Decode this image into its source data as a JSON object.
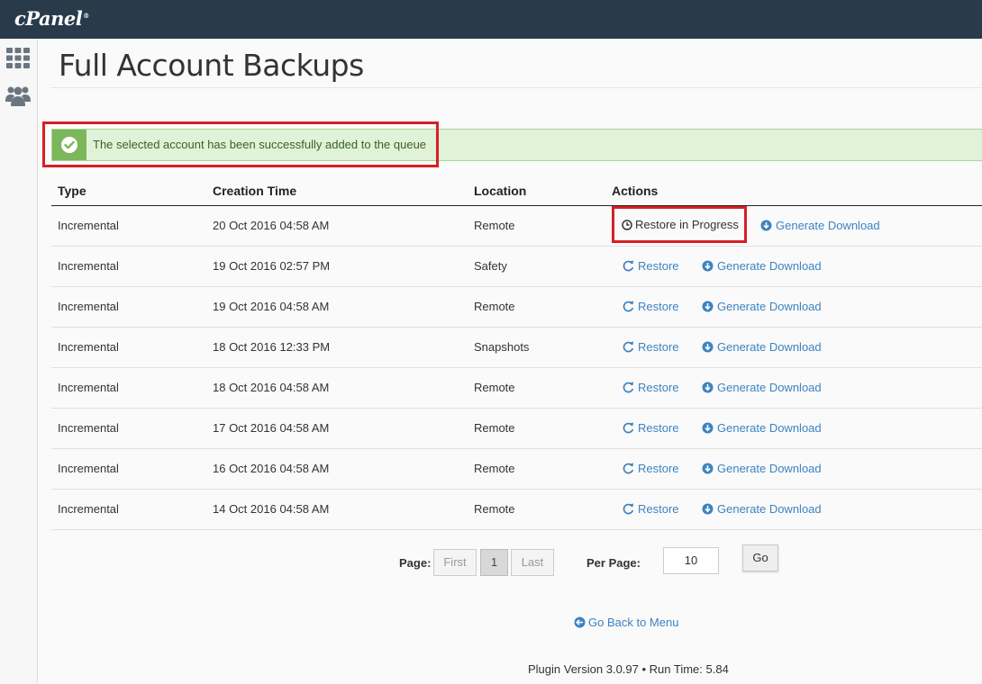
{
  "app": {
    "logo": "cPanel",
    "logo_mark": "®"
  },
  "page": {
    "title": "Full Account Backups"
  },
  "alert": {
    "message": "The selected account has been successfully added to the queue"
  },
  "table": {
    "headers": {
      "type": "Type",
      "time": "Creation Time",
      "location": "Location",
      "actions": "Actions"
    },
    "rows": [
      {
        "type": "Incremental",
        "time": "20 Oct 2016 04:58 AM",
        "location": "Remote",
        "status": "Restore in Progress",
        "download": "Generate Download"
      },
      {
        "type": "Incremental",
        "time": "19 Oct 2016 02:57 PM",
        "location": "Safety",
        "restore": "Restore",
        "download": "Generate Download"
      },
      {
        "type": "Incremental",
        "time": "19 Oct 2016 04:58 AM",
        "location": "Remote",
        "restore": "Restore",
        "download": "Generate Download"
      },
      {
        "type": "Incremental",
        "time": "18 Oct 2016 12:33 PM",
        "location": "Snapshots",
        "restore": "Restore",
        "download": "Generate Download"
      },
      {
        "type": "Incremental",
        "time": "18 Oct 2016 04:58 AM",
        "location": "Remote",
        "restore": "Restore",
        "download": "Generate Download"
      },
      {
        "type": "Incremental",
        "time": "17 Oct 2016 04:58 AM",
        "location": "Remote",
        "restore": "Restore",
        "download": "Generate Download"
      },
      {
        "type": "Incremental",
        "time": "16 Oct 2016 04:58 AM",
        "location": "Remote",
        "restore": "Restore",
        "download": "Generate Download"
      },
      {
        "type": "Incremental",
        "time": "14 Oct 2016 04:58 AM",
        "location": "Remote",
        "restore": "Restore",
        "download": "Generate Download"
      }
    ]
  },
  "pagination": {
    "page_label": "Page:",
    "first": "First",
    "current": "1",
    "last": "Last",
    "per_page_label": "Per Page:",
    "per_page_value": "10",
    "go": "Go"
  },
  "back_link": "Go Back to Menu",
  "footer": "Plugin Version 3.0.97 • Run Time: 5.84",
  "icons": {
    "sidebar": [
      "grid-icon",
      "users-icon"
    ],
    "alert": "check-circle-icon",
    "restore": "refresh-icon",
    "download": "download-circle-icon",
    "progress": "clock-icon",
    "back": "arrow-left-circle-icon"
  },
  "colors": {
    "topbar": "#293a4a",
    "link": "#3d83c2",
    "success_bg": "#e0f2d8",
    "success_icon": "#7cb75b",
    "highlight": "#d61f26"
  }
}
